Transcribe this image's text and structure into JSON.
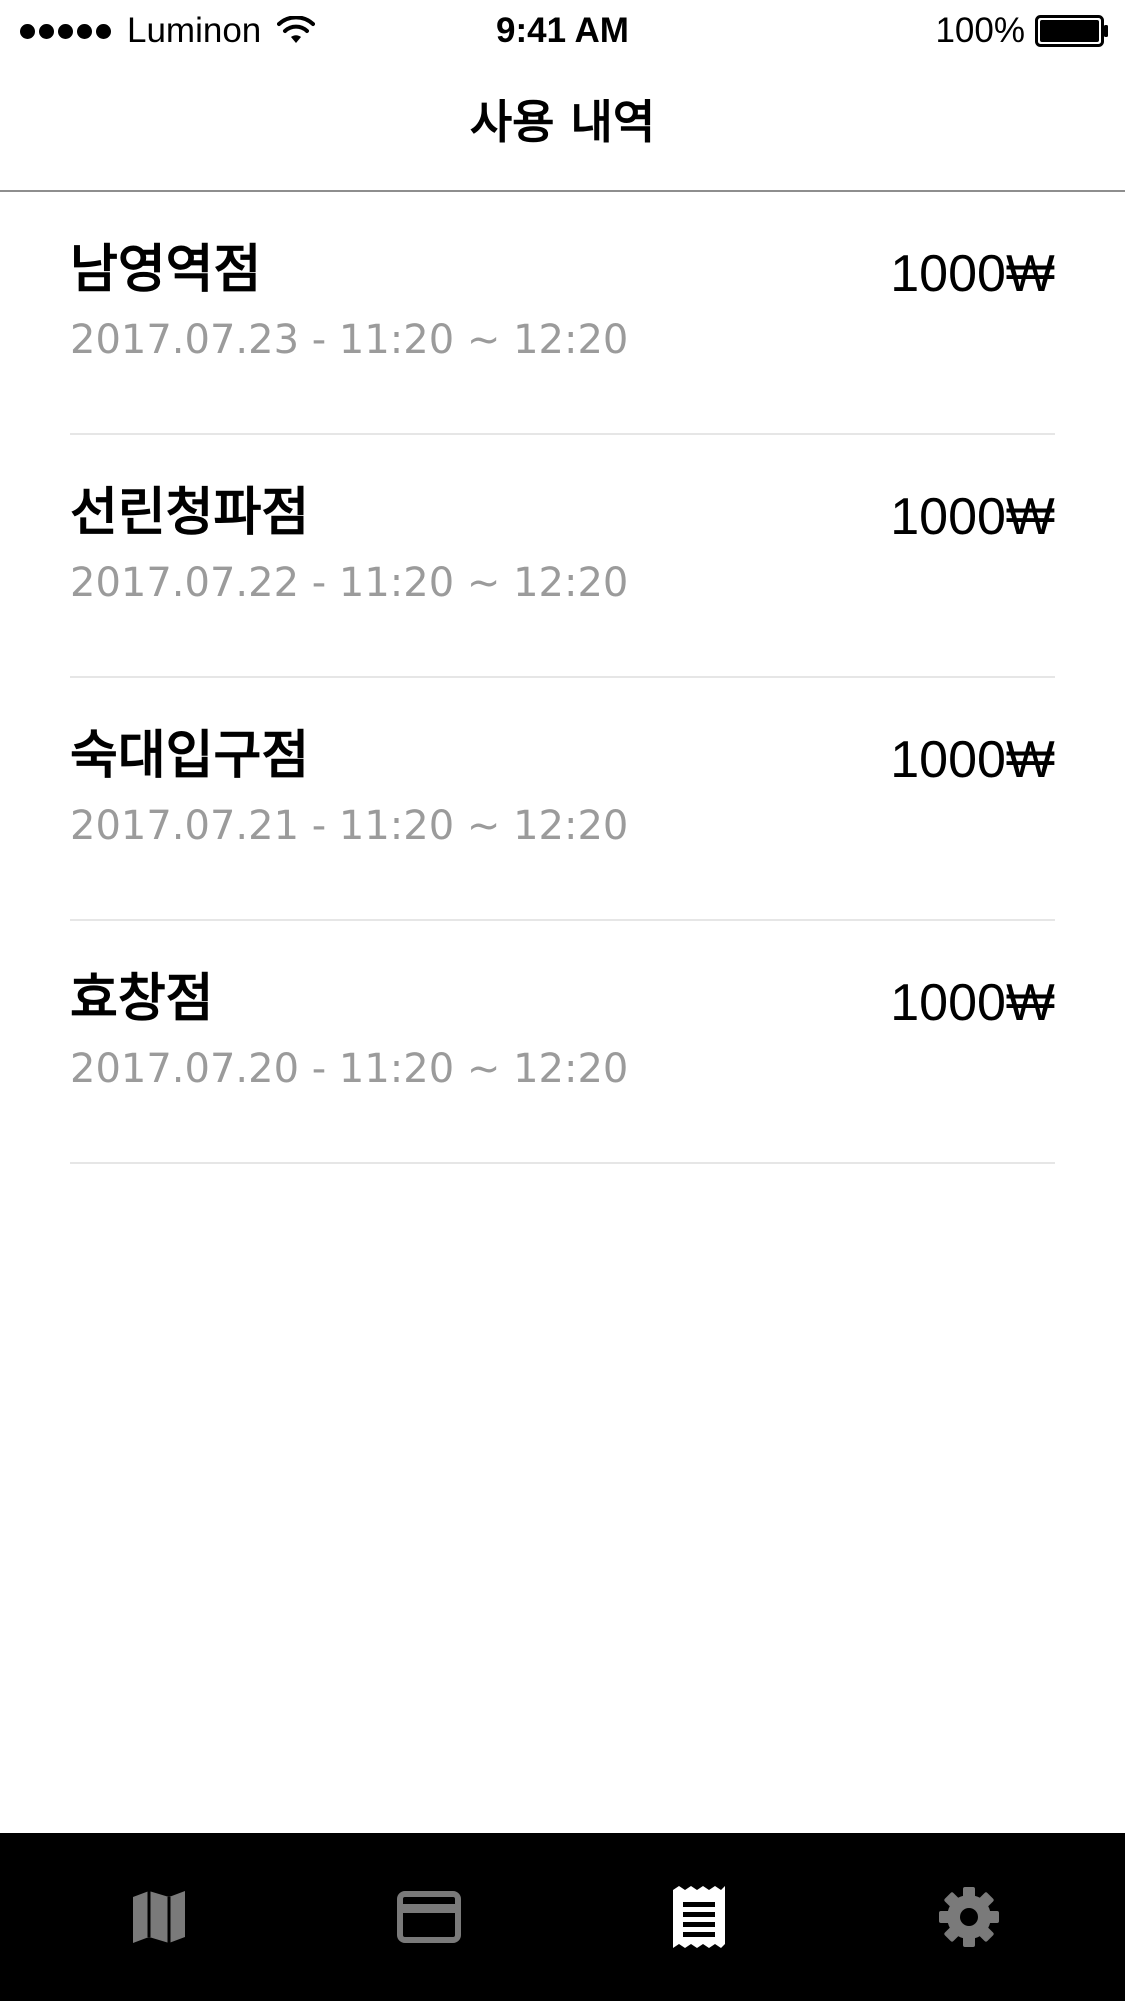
{
  "status_bar": {
    "carrier": "Luminon",
    "time": "9:41 AM",
    "battery": "100%"
  },
  "nav": {
    "title": "사용 내역"
  },
  "history": [
    {
      "store": "남영역점",
      "date": "2017.07.23 - 11:20 ~ 12:20",
      "amount": "1000₩"
    },
    {
      "store": "선린청파점",
      "date": "2017.07.22 - 11:20 ~ 12:20",
      "amount": "1000₩"
    },
    {
      "store": "숙대입구점",
      "date": "2017.07.21 - 11:20 ~ 12:20",
      "amount": "1000₩"
    },
    {
      "store": "효창점",
      "date": "2017.07.20 - 11:20 ~ 12:20",
      "amount": "1000₩"
    }
  ],
  "tabs": [
    {
      "icon": "map-icon",
      "active": false
    },
    {
      "icon": "card-icon",
      "active": false
    },
    {
      "icon": "receipt-icon",
      "active": true
    },
    {
      "icon": "gear-icon",
      "active": false
    }
  ],
  "colors": {
    "text_primary": "#000000",
    "text_secondary": "#9b9b9b",
    "divider": "#e6e6e6",
    "tab_bar_bg": "#000000",
    "tab_icon_inactive": "#7a7a7a",
    "tab_icon_active": "#ffffff"
  }
}
